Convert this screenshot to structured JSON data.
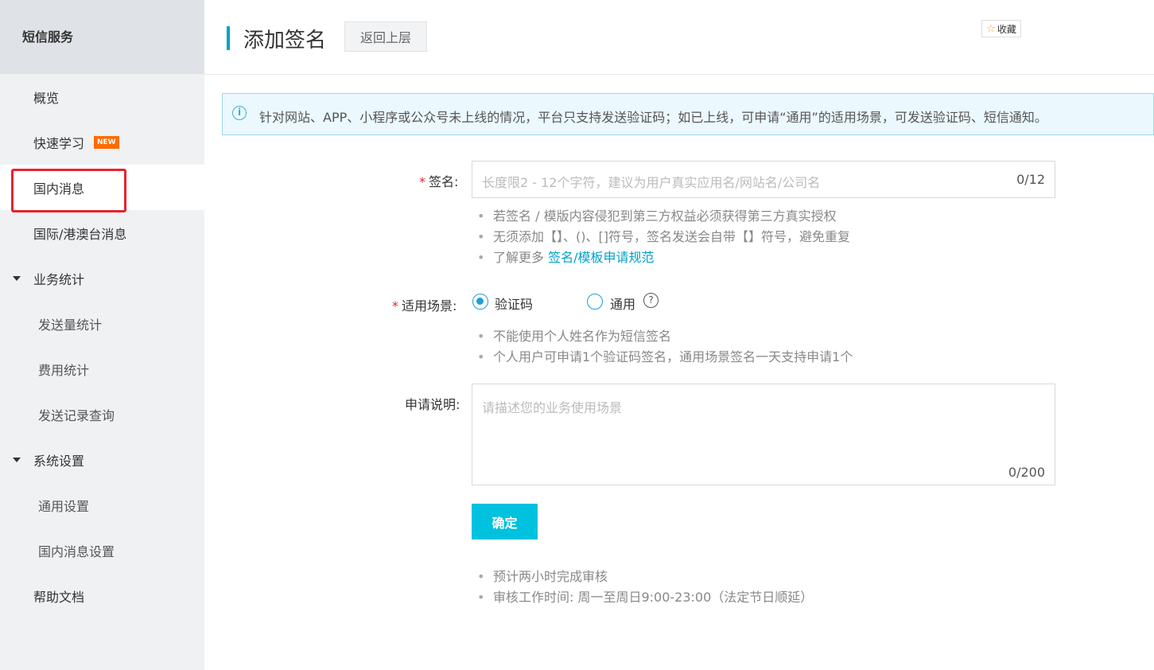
{
  "sidebar": {
    "title": "短信服务",
    "items": [
      {
        "label": "概览"
      },
      {
        "label": "快速学习",
        "badge": "NEW"
      },
      {
        "label": "国内消息"
      },
      {
        "label": "国际/港澳台消息"
      },
      {
        "label": "业务统计"
      },
      {
        "label": "发送量统计"
      },
      {
        "label": "费用统计"
      },
      {
        "label": "发送记录查询"
      },
      {
        "label": "系统设置"
      },
      {
        "label": "通用设置"
      },
      {
        "label": "国内消息设置"
      },
      {
        "label": "帮助文档"
      }
    ]
  },
  "header": {
    "title": "添加签名",
    "back_label": "返回上层",
    "favorite_label": "收藏"
  },
  "banner": {
    "text": "针对网站、APP、小程序或公众号未上线的情况，平台只支持发送验证码；如已上线，可申请“通用”的适用场景，可发送验证码、短信通知。"
  },
  "form": {
    "signature": {
      "required_mark": "*",
      "label": "签名:",
      "placeholder": "长度限2 - 12个字符，建议为用户真实应用名/网站名/公司名",
      "counter": "0/12",
      "hints": [
        "若签名 / 模版内容侵犯到第三方权益必须获得第三方真实授权",
        "无须添加【】、()、[]符号，签名发送会自带【】符号，避免重复"
      ],
      "learn_more_prefix": "了解更多 ",
      "learn_more_link": "签名/模板申请规范"
    },
    "scene": {
      "required_mark": "*",
      "label": "适用场景:",
      "options": [
        {
          "label": "验证码",
          "checked": true
        },
        {
          "label": "通用",
          "checked": false
        }
      ],
      "help_symbol": "?",
      "hints": [
        "不能使用个人姓名作为短信签名",
        "个人用户可申请1个验证码签名，通用场景签名一天支持申请1个"
      ]
    },
    "description": {
      "label": "申请说明:",
      "placeholder": "请描述您的业务使用场景",
      "counter": "0/200"
    },
    "submit_label": "确定",
    "footer_hints": [
      "预计两小时完成审核",
      "审核工作时间: 周一至周日9:00-23:00（法定节日顺延）"
    ]
  },
  "colors": {
    "accent": "#00a2ca",
    "button": "#00c1de",
    "highlight": "#e8232d",
    "badge": "#ff6a00"
  }
}
